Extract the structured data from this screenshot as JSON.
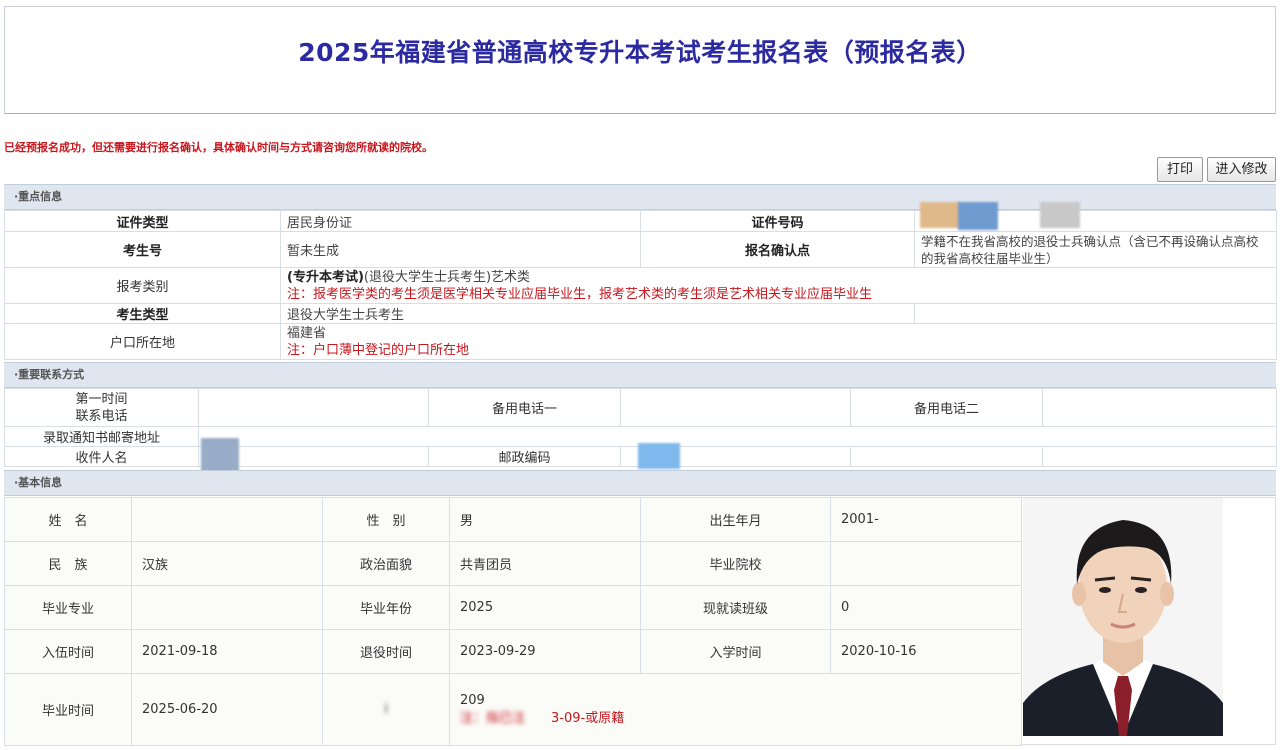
{
  "title": "2025年福建省普通高校专升本考试考生报名表（预报名表）",
  "notice": "已经预报名成功，但还需要进行报名确认，具体确认时间与方式请咨询您所就读的院校。",
  "buttons": {
    "print": "打印",
    "edit": "进入修改"
  },
  "sections": {
    "key_info": "·重点信息",
    "contact": "·重要联系方式",
    "basic": "·基本信息"
  },
  "key_info": {
    "id_type_label": "证件类型",
    "id_type_value": "居民身份证",
    "id_number_label": "证件号码",
    "candidate_no_label": "考生号",
    "candidate_no_value": "暂未生成",
    "confirm_point_label": "报名确认点",
    "confirm_point_value": "学籍不在我省高校的退役士兵确认点（含已不再设确认点高校的我省高校往届毕业生）",
    "category_label": "报考类别",
    "category_prefix": "(专升本考试)",
    "category_value": "(退役大学生士兵考生)艺术类",
    "category_note": "注：报考医学类的考生须是医学相关专业应届毕业生，报考艺术类的考生须是艺术相关专业应届毕业生",
    "candidate_type_label": "考生类型",
    "candidate_type_value": "退役大学生士兵考生",
    "hukou_label": "户口所在地",
    "hukou_value": "福建省",
    "hukou_note": "注：户口薄中登记的户口所在地"
  },
  "contact": {
    "first_phone_label_1": "第一时间",
    "first_phone_label_2": "联系电话",
    "backup_phone_1_label": "备用电话一",
    "backup_phone_2_label": "备用电话二",
    "address_label": "录取通知书邮寄地址",
    "recipient_label": "收件人名",
    "postcode_label": "邮政编码"
  },
  "basic": {
    "name_label": "姓　名",
    "gender_label": "性　别",
    "gender_value": "男",
    "birth_label": "出生年月",
    "birth_value": "2001-",
    "ethnicity_label": "民　族",
    "ethnicity_value": "汉族",
    "political_label": "政治面貌",
    "political_value": "共青团员",
    "school_label": "毕业院校",
    "major_label": "毕业专业",
    "grad_year_label": "毕业年份",
    "grad_year_value": "2025",
    "class_label": "现就读班级",
    "class_value": "0",
    "enlist_label": "入伍时间",
    "enlist_value": "2021-09-18",
    "discharge_label": "退役时间",
    "discharge_value": "2023-09-29",
    "enroll_label": "入学时间",
    "enroll_value": "2020-10-16",
    "grad_time_label": "毕业时间",
    "grad_time_value": "2025-06-20",
    "partial_label": "i",
    "partial_value_1": "209",
    "partial_value_2": "注：指已注",
    "partial_value_3": "3-09-或原籍"
  },
  "colors": {
    "title": "#2b2aa0",
    "notice": "#c8161d",
    "section_bg": "#dfe6f0"
  },
  "icons": {
    "photo": "person-photo"
  }
}
